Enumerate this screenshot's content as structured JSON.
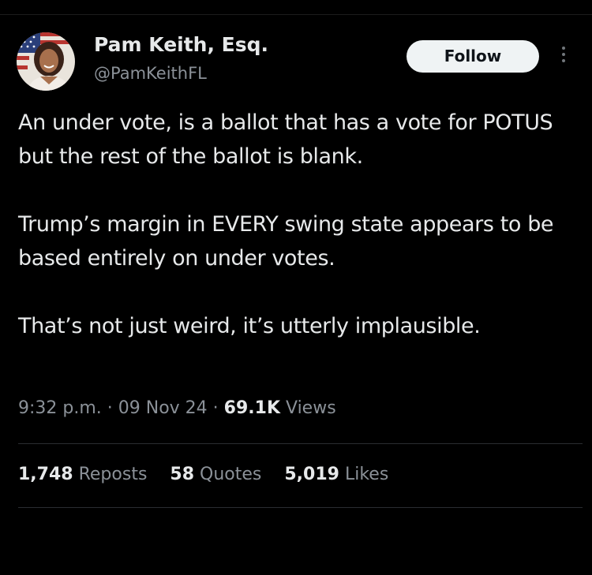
{
  "author": {
    "display_name": "Pam Keith, Esq.",
    "handle": "@PamKeithFL",
    "avatar_icon": "profile-photo-with-flag"
  },
  "actions": {
    "follow_label": "Follow",
    "more_icon": "more-vertical-icon"
  },
  "tweet": {
    "paragraphs": [
      "An under vote, is a ballot that has a vote for POTUS but the rest of the ballot is blank.",
      "Trump’s margin in EVERY swing state appears to be based entirely on under votes.",
      "That’s not just weird, it’s utterly implausible."
    ]
  },
  "meta": {
    "time": "9:32 p.m.",
    "separator": " · ",
    "date": "09 Nov 24",
    "views_count": "69.1K",
    "views_label": "Views"
  },
  "stats": {
    "reposts_count": "1,748",
    "reposts_label": "Reposts",
    "quotes_count": "58",
    "quotes_label": "Quotes",
    "likes_count": "5,019",
    "likes_label": "Likes"
  },
  "colors": {
    "background": "#000000",
    "primary_text": "#e7e9ea",
    "secondary_text": "#8b9198",
    "button_bg": "#eff3f4",
    "button_text": "#0f1419",
    "divider": "#2a2d31"
  }
}
